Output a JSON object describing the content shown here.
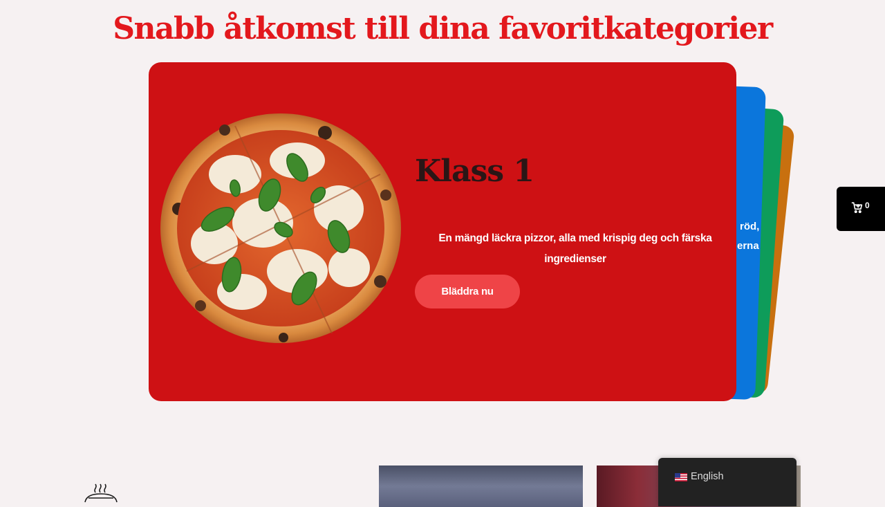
{
  "section": {
    "title": "Snabb åtkomst till dina favoritkategorier"
  },
  "carousel": {
    "active_card": {
      "title": "Klass 1",
      "description": "En mängd läckra pizzor, alla med krispig deg och färska ingredienser",
      "button_label": "Bläddra nu",
      "background_color": "#ce1114"
    },
    "back_cards": [
      {
        "color": "#0b76dc",
        "visible_text": "röd,"
      },
      {
        "color": "#0e9c5a",
        "visible_text": "erna"
      },
      {
        "color": "#c8700f"
      }
    ]
  },
  "side_cart": {
    "icon": "cart-icon",
    "count": "0"
  },
  "language_switcher": {
    "flag": "us-flag-icon",
    "label": "English"
  },
  "colors": {
    "accent": "#e3181d",
    "page_background": "#f6f1f2",
    "button": "#ef4447"
  }
}
